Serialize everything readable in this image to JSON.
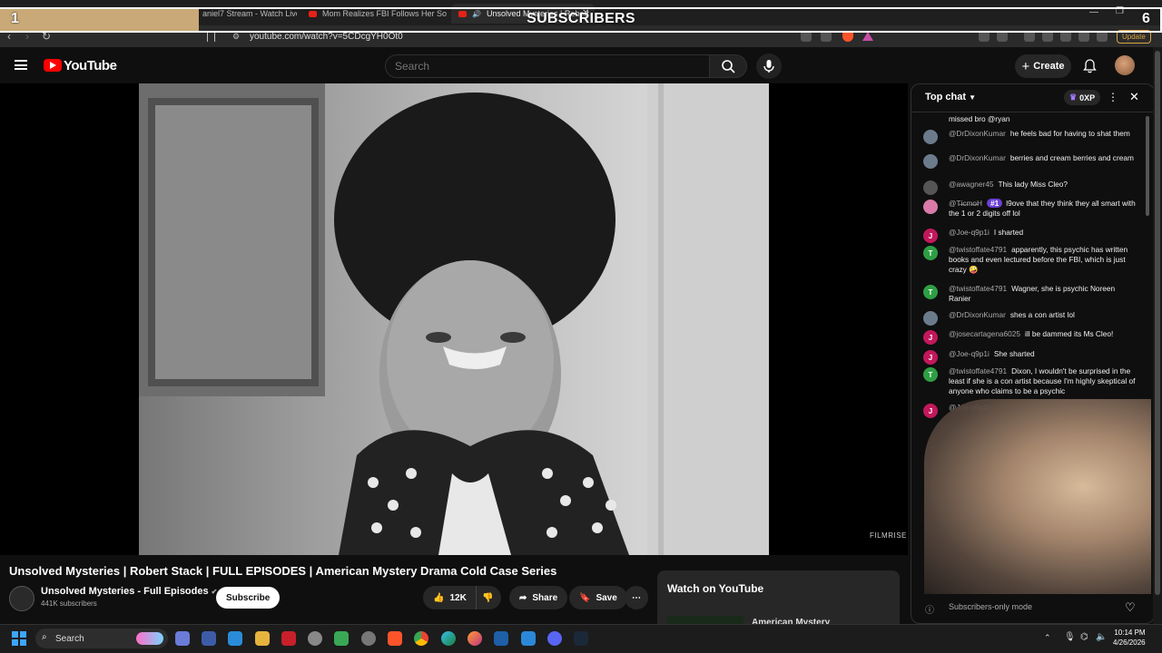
{
  "overlay": {
    "left_count": "1",
    "right_count": "6",
    "label": "SUBSCRIBERS"
  },
  "browser": {
    "tabs": [
      {
        "title": "aniel7 Stream - Watch Live o"
      },
      {
        "title": "Mom Realizes FBI Follows Her Son's"
      },
      {
        "title": "Unsolved Mysteries | Robert"
      }
    ],
    "url": "youtube.com/watch?v=5CDcgYH0Ot0",
    "update_label": "Update"
  },
  "youtube": {
    "logo_text": "YouTube",
    "search_placeholder": "Search",
    "create_label": "Create"
  },
  "video": {
    "watermark": "FILMRISE",
    "title": "Unsolved Mysteries | Robert Stack | FULL EPISODES | American Mystery Drama Cold Case Series",
    "channel_name": "Unsolved Mysteries - Full Episodes",
    "subscribers": "441K subscribers",
    "subscribe_label": "Subscribe",
    "likes": "12K",
    "share_label": "Share",
    "save_label": "Save"
  },
  "side": {
    "watch_label": "Watch on YouTube",
    "rec_title": "American Mystery"
  },
  "chat": {
    "header": "Top chat",
    "points_label": "0XP",
    "badge_label": "#1",
    "input_placeholder": "Subscribers-only mode",
    "messages": [
      {
        "author": "",
        "text": "missed bro @ryan",
        "avatar": "",
        "color": "#5f4a8a"
      },
      {
        "author": "@DrDixonKumar",
        "text": "he feels bad for having to shat them",
        "avatar": "",
        "color": "#6b7b8c"
      },
      {
        "author": "@DrDixonKumar",
        "text": "berries and cream berries and cream",
        "avatar": "",
        "color": "#6b7b8c"
      },
      {
        "author": "@awagner45",
        "text": "This lady Miss Cleo?",
        "avatar": "",
        "color": "#555555"
      },
      {
        "author": "@T̶i̶c̶m̶o̶H",
        "text": "l9ove that they think they all smart with the 1 or 2 digits off lol",
        "avatar": "",
        "color": "#d97aa8"
      },
      {
        "author": "@Joe-q9p1i",
        "text": "I sharted",
        "avatar": "J",
        "color": "#c2185b"
      },
      {
        "author": "@twistoffate4791",
        "text": "apparently, this psychic has written books and even lectured before the FBI, which is just crazy 🤪",
        "avatar": "T",
        "color": "#2e9e44"
      },
      {
        "author": "@twistoffate4791",
        "text": "Wagner, she is psychic Noreen Ranier",
        "avatar": "T",
        "color": "#2e9e44"
      },
      {
        "author": "@DrDixonKumar",
        "text": "shes a con artist lol",
        "avatar": "",
        "color": "#6b7b8c"
      },
      {
        "author": "@josecartagena6025",
        "text": "ill be dammed its Ms Cleo!",
        "avatar": "J",
        "color": "#c2185b"
      },
      {
        "author": "@Joe-q9p1i",
        "text": "She sharted",
        "avatar": "J",
        "color": "#c2185b"
      },
      {
        "author": "@twistoffate4791",
        "text": "Dixon, I wouldn't be surprised in the least if she is a con artist because I'm highly skeptical of anyone who claims to be a psychic",
        "avatar": "T",
        "color": "#2e9e44"
      },
      {
        "author": "@Joe-q9p1i",
        "text": "",
        "avatar": "J",
        "color": "#c2185b"
      }
    ]
  },
  "taskbar": {
    "search_label": "Search",
    "time": "10:14 PM",
    "date": "4/26/2026"
  },
  "colors": {
    "accent": "#ff0000",
    "update": "#d9a441",
    "brave": "#fb542b"
  }
}
